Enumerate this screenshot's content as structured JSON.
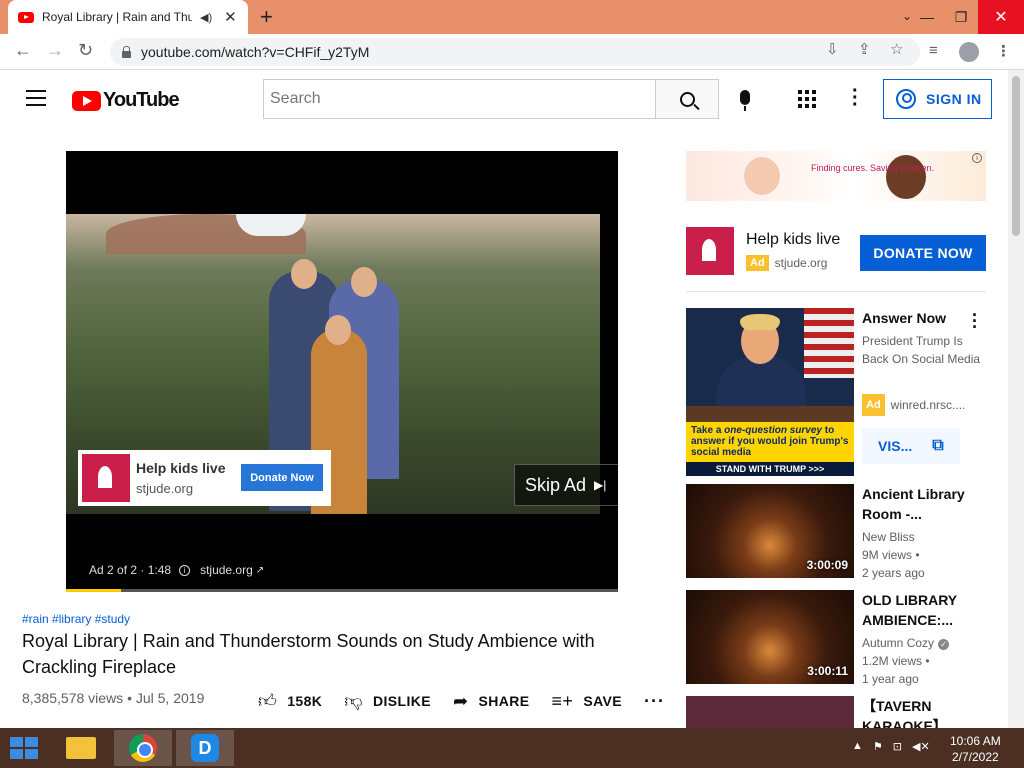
{
  "browser": {
    "tab_title": "Royal Library | Rain and Thunderstorm Sounds on Study Ambience with Crackling Fireplace",
    "tab_audio_icon": "speaker-icon",
    "url": "youtube.com/watch?v=CHFif_y2TyM",
    "new_tab_glyph": "+",
    "close_glyph": "✕"
  },
  "youtube": {
    "logo_text": "YouTube",
    "search_placeholder": "Search",
    "sign_in_label": "SIGN IN"
  },
  "player": {
    "ad_card": {
      "title": "Help kids live",
      "domain": "stjude.org",
      "button": "Donate Now"
    },
    "skip_label": "Skip Ad",
    "ad_counter": "Ad 2 of 2 · 1:48",
    "ad_domain": "stjude.org",
    "ad_progress_fraction": 0.1
  },
  "video": {
    "tags": "#rain #library #study",
    "title": "Royal Library | Rain and Thunderstorm Sounds on Study Ambience with Crackling Fireplace",
    "meta": "8,385,578 views • Jul 5, 2019",
    "like_count": "158K",
    "dislike_label": "DISLIKE",
    "share_label": "SHARE",
    "save_label": "SAVE"
  },
  "sidebar": {
    "banner_text": "Finding cures. Saving children.",
    "ad": {
      "title": "Help kids live",
      "badge": "Ad",
      "domain": "stjude.org",
      "button": "DONATE NOW"
    },
    "promo": {
      "title": "Answer Now",
      "description": "President Trump Is Back On Social Media",
      "badge": "Ad",
      "domain": "winred.nrsc....",
      "visit_label": "VIS...",
      "thumb_text_1": "Take a",
      "thumb_text_em": "one-question survey",
      "thumb_text_2": "to answer if you would join Trump's social media",
      "thumb_footer": "STAND WITH TRUMP >>>"
    },
    "recs": [
      {
        "title": "Ancient Library Room -...",
        "channel": "New Bliss",
        "views": "9M views •",
        "age": "2 years ago",
        "duration": "3:00:09"
      },
      {
        "title": "OLD LIBRARY AMBIENCE:...",
        "channel": "Autumn Cozy",
        "views": "1.2M views •",
        "age": "1 year ago",
        "duration": "3:00:11"
      },
      {
        "title": "【TAVERN KARAOKE】"
      }
    ]
  },
  "taskbar": {
    "time": "10:06 AM",
    "date": "2/7/2022"
  }
}
